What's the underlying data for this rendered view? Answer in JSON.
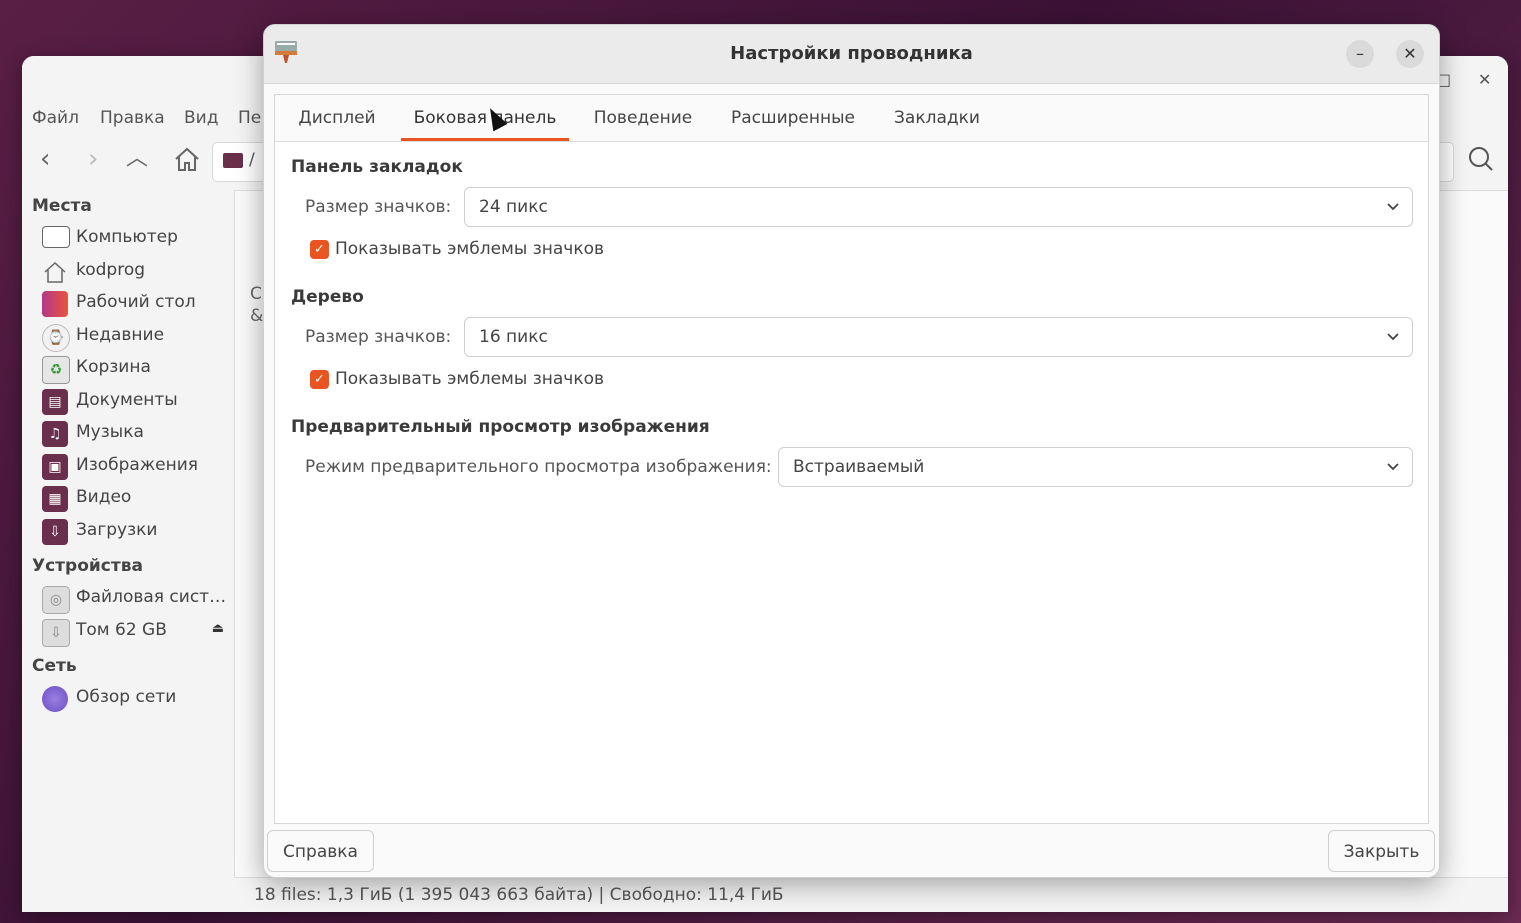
{
  "file_manager": {
    "menu": [
      "Файл",
      "Правка",
      "Вид",
      "Пе"
    ],
    "path_fragment": "/",
    "sidebar": {
      "places_header": "Места",
      "places": [
        {
          "label": "Компьютер",
          "icon": "computer-icon"
        },
        {
          "label": "kodprog",
          "icon": "home-icon"
        },
        {
          "label": "Рабочий стол",
          "icon": "desktop-folder-icon"
        },
        {
          "label": "Недавние",
          "icon": "recent-clock-icon"
        },
        {
          "label": "Корзина",
          "icon": "trash-icon"
        },
        {
          "label": "Документы",
          "icon": "documents-folder-icon"
        },
        {
          "label": "Музыка",
          "icon": "music-folder-icon"
        },
        {
          "label": "Изображения",
          "icon": "pictures-folder-icon"
        },
        {
          "label": "Видео",
          "icon": "videos-folder-icon"
        },
        {
          "label": "Загрузки",
          "icon": "downloads-folder-icon"
        }
      ],
      "devices_header": "Устройства",
      "devices": [
        {
          "label": "Файловая сист…",
          "icon": "drive-icon"
        },
        {
          "label": "Том 62 GB",
          "icon": "usb-drive-icon"
        }
      ],
      "network_header": "Сеть",
      "network": [
        {
          "label": "Обзор сети",
          "icon": "network-icon"
        }
      ]
    },
    "content_fragments": [
      "С",
      "&"
    ],
    "status": "18 files: 1,3 ГиБ (1 395 043 663 байта) | Свободно: 11,4 ГиБ"
  },
  "dialog": {
    "title": "Настройки проводника",
    "tabs": [
      "Дисплей",
      "Боковая панель",
      "Поведение",
      "Расширенные",
      "Закладки"
    ],
    "active_tab": "Боковая панель",
    "bookmarks_section": {
      "title": "Панель закладок",
      "icon_size_label": "Размер значков:",
      "icon_size_value": "24 пикс",
      "show_emblems_label": "Показывать эмблемы значков",
      "show_emblems_checked": true
    },
    "tree_section": {
      "title": "Дерево",
      "icon_size_label": "Размер значков:",
      "icon_size_value": "16 пикс",
      "show_emblems_label": "Показывать эмблемы значков",
      "show_emblems_checked": true
    },
    "preview_section": {
      "title": "Предварительный просмотр изображения",
      "mode_label": "Режим предварительного просмотра изображения:",
      "mode_value": "Встраиваемый"
    },
    "help_button": "Справка",
    "close_button": "Закрыть"
  },
  "colors": {
    "accent": "#e95420",
    "folder": "#6a2f4b"
  }
}
